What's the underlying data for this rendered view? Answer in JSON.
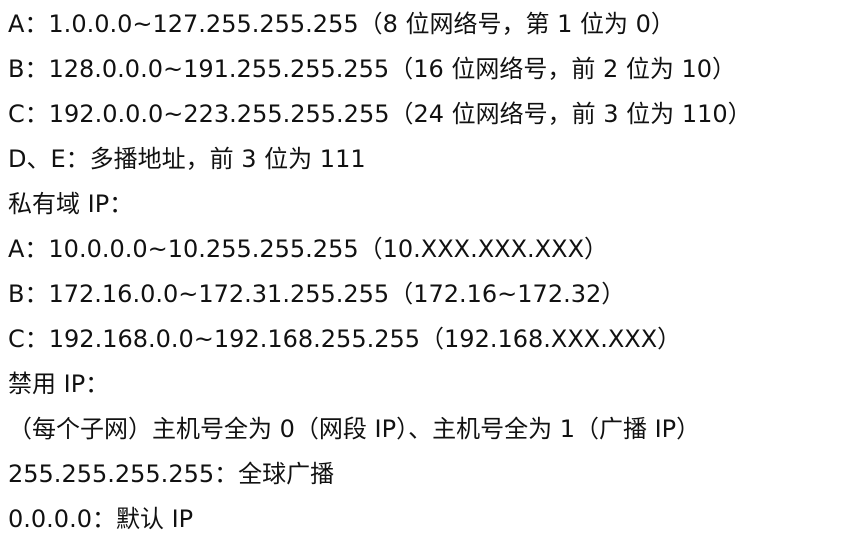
{
  "lines": [
    "A：1.0.0.0~127.255.255.255（8 位网络号，第 1 位为 0）",
    "B：128.0.0.0~191.255.255.255（16 位网络号，前 2 位为 10）",
    "C：192.0.0.0~223.255.255.255（24 位网络号，前 3 位为 110）",
    "D、E：多播地址，前 3 位为 111",
    "私有域 IP：",
    "A：10.0.0.0~10.255.255.255（10.XXX.XXX.XXX）",
    "B：172.16.0.0~172.31.255.255（172.16~172.32）",
    "C：192.168.0.0~192.168.255.255（192.168.XXX.XXX）",
    "禁用 IP：",
    "（每个子网）主机号全为 0（网段 IP）、主机号全为 1（广播 IP）",
    "255.255.255.255：全球广播",
    "0.0.0.0：默认 IP"
  ]
}
